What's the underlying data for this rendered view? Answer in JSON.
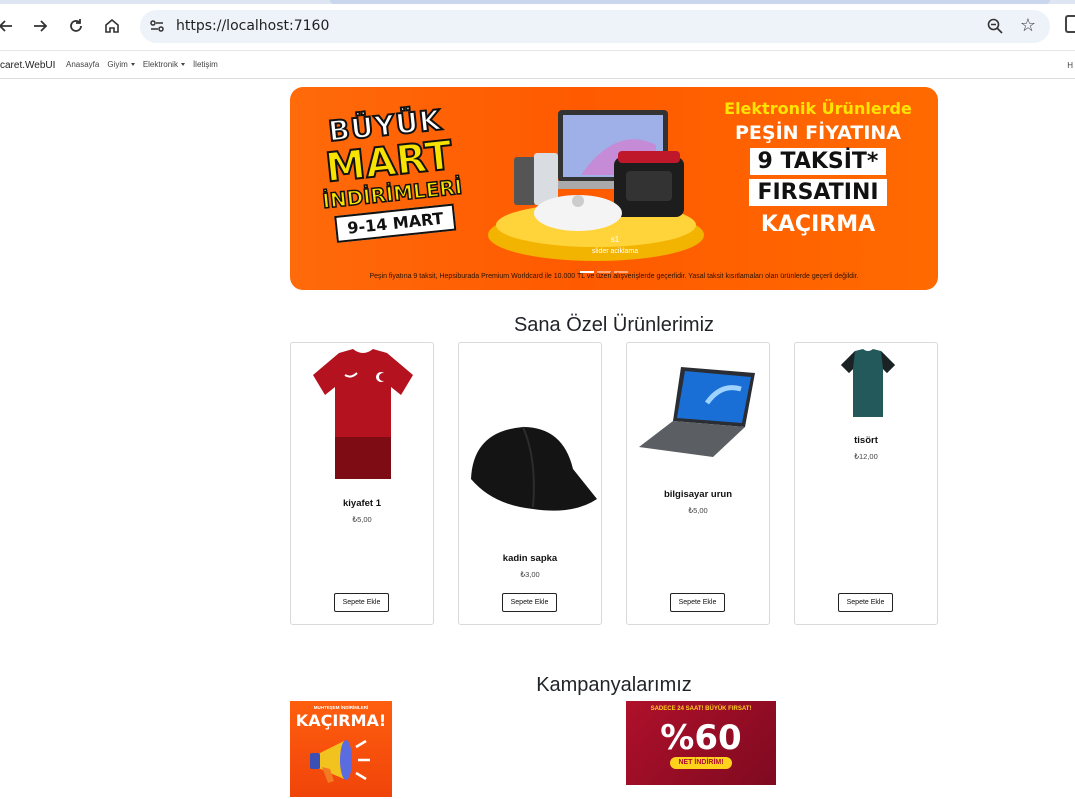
{
  "browser": {
    "url": "https://localhost:7160",
    "icons": [
      "back-icon",
      "forward-icon",
      "reload-icon",
      "home-icon",
      "site-settings-icon",
      "zoom-icon",
      "bookmark-star-icon"
    ]
  },
  "navbar": {
    "brand": "caret.WebUI",
    "links": [
      {
        "label": "Anasayfa"
      },
      {
        "label": "Giyim"
      },
      {
        "label": "Elektronik"
      },
      {
        "label": "İletişim"
      }
    ],
    "right_label": "H"
  },
  "banner": {
    "title_lines": [
      "BÜYÜK",
      "MART",
      "İNDİRİMLERİ",
      "9-14 MART"
    ],
    "right_lines": [
      "Elektronik Ürünlerde",
      "PEŞİN FİYATINA",
      "9 TAKSİT*",
      "FIRSATINI",
      "KAÇIRMA"
    ],
    "footnote": "Peşin fiyatına 9 taksit, Hepsiburada Premium Worldcard ile 10.000 TL ve üzeri alışverişlerde geçerlidir. Yasal taksit kısıtlamaları olan ürünlerde geçerli değildir.",
    "slide_label": "s1",
    "slide_caption": "slider aciklama",
    "colors": {
      "primary": "#ff5a00",
      "yellow": "#f7e200"
    }
  },
  "products_section": {
    "title": "Sana Özel Ürünlerimiz",
    "add_label": "Sepete Ekle",
    "items": [
      {
        "name": "kiyafet 1",
        "price": "₺5,00",
        "image": "red-jersey"
      },
      {
        "name": "kadin sapka",
        "price": "₺3,00",
        "image": "black-cap"
      },
      {
        "name": "bilgisayar urun",
        "price": "₺5,00",
        "image": "laptop"
      },
      {
        "name": "tisört",
        "price": "₺12,00",
        "image": "green-tshirt"
      }
    ]
  },
  "campaigns_section": {
    "title": "Kampanyalarımız",
    "items": [
      {
        "top": "MUHTEŞEM İNDİRİMLERİ",
        "headline": "KAÇIRMA!",
        "image": "megaphone"
      },
      {
        "top": "SADECE 24 SAAT! BÜYÜK FIRSAT!",
        "headline": "%60",
        "sub": "NET İNDİRİM!"
      }
    ]
  }
}
